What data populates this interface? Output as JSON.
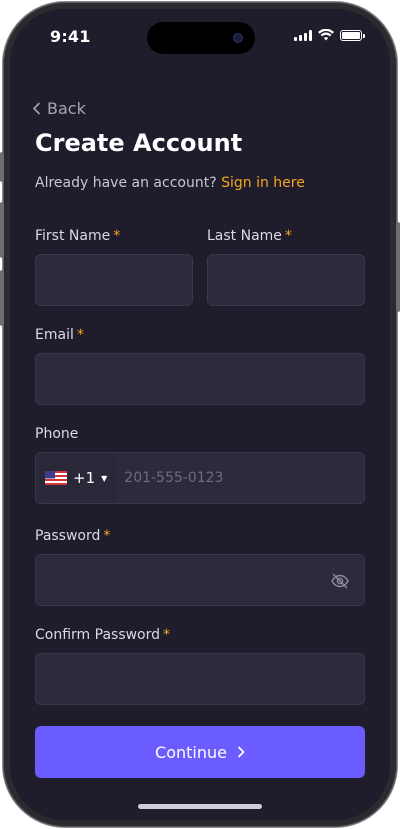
{
  "status_bar": {
    "time": "9:41",
    "icons": [
      "cellular-signal-icon",
      "wifi-icon",
      "battery-icon"
    ]
  },
  "nav": {
    "back_label": "Back"
  },
  "header": {
    "title": "Create Account",
    "signin_prompt": "Already have an account?",
    "signin_link": "Sign in here"
  },
  "form": {
    "required_marker": "*",
    "first_name": {
      "label": "First Name",
      "value": "",
      "placeholder": ""
    },
    "last_name": {
      "label": "Last Name",
      "value": "",
      "placeholder": ""
    },
    "email": {
      "label": "Email",
      "value": "",
      "placeholder": ""
    },
    "phone": {
      "label": "Phone",
      "country_flag": "us-flag-icon",
      "dial_code": "+1",
      "placeholder": "201-555-0123",
      "value": ""
    },
    "password": {
      "label": "Password",
      "value": "",
      "placeholder": "",
      "toggle_icon": "eye-off-icon"
    },
    "confirm_password": {
      "label": "Confirm Password",
      "value": "",
      "placeholder": ""
    },
    "submit_label": "Continue"
  },
  "colors": {
    "background": "#1f1c2b",
    "field_bg": "#2c2a3d",
    "accent": "#6b5cff",
    "link": "#f5a623",
    "muted_text": "#a6a3b5"
  }
}
